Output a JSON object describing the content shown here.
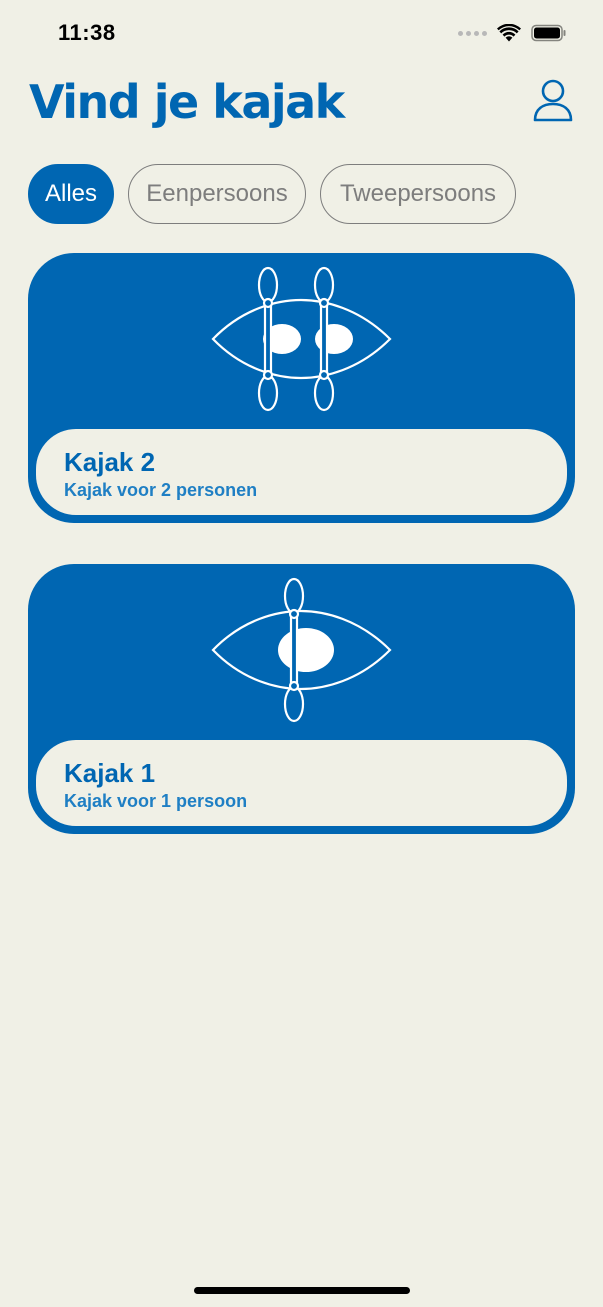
{
  "status_bar": {
    "time": "11:38"
  },
  "header": {
    "title": "Vind je kajak",
    "profile_icon": "person-outline-icon"
  },
  "filters": [
    {
      "label": "Alles",
      "active": true
    },
    {
      "label": "Eenpersoons",
      "active": false
    },
    {
      "label": "Tweepersoons",
      "active": false
    }
  ],
  "kayaks": [
    {
      "title": "Kajak 2",
      "subtitle": "Kajak voor 2 personen",
      "icon": "double-kayak-icon",
      "seats": 2
    },
    {
      "title": "Kajak 1",
      "subtitle": "Kajak voor 1 persoon",
      "icon": "single-kayak-icon",
      "seats": 1
    }
  ],
  "colors": {
    "accent": "#0066b2",
    "background": "#f0f0e6",
    "subtitle": "#1f7fc4",
    "chip_inactive": "#7d7d7d"
  }
}
